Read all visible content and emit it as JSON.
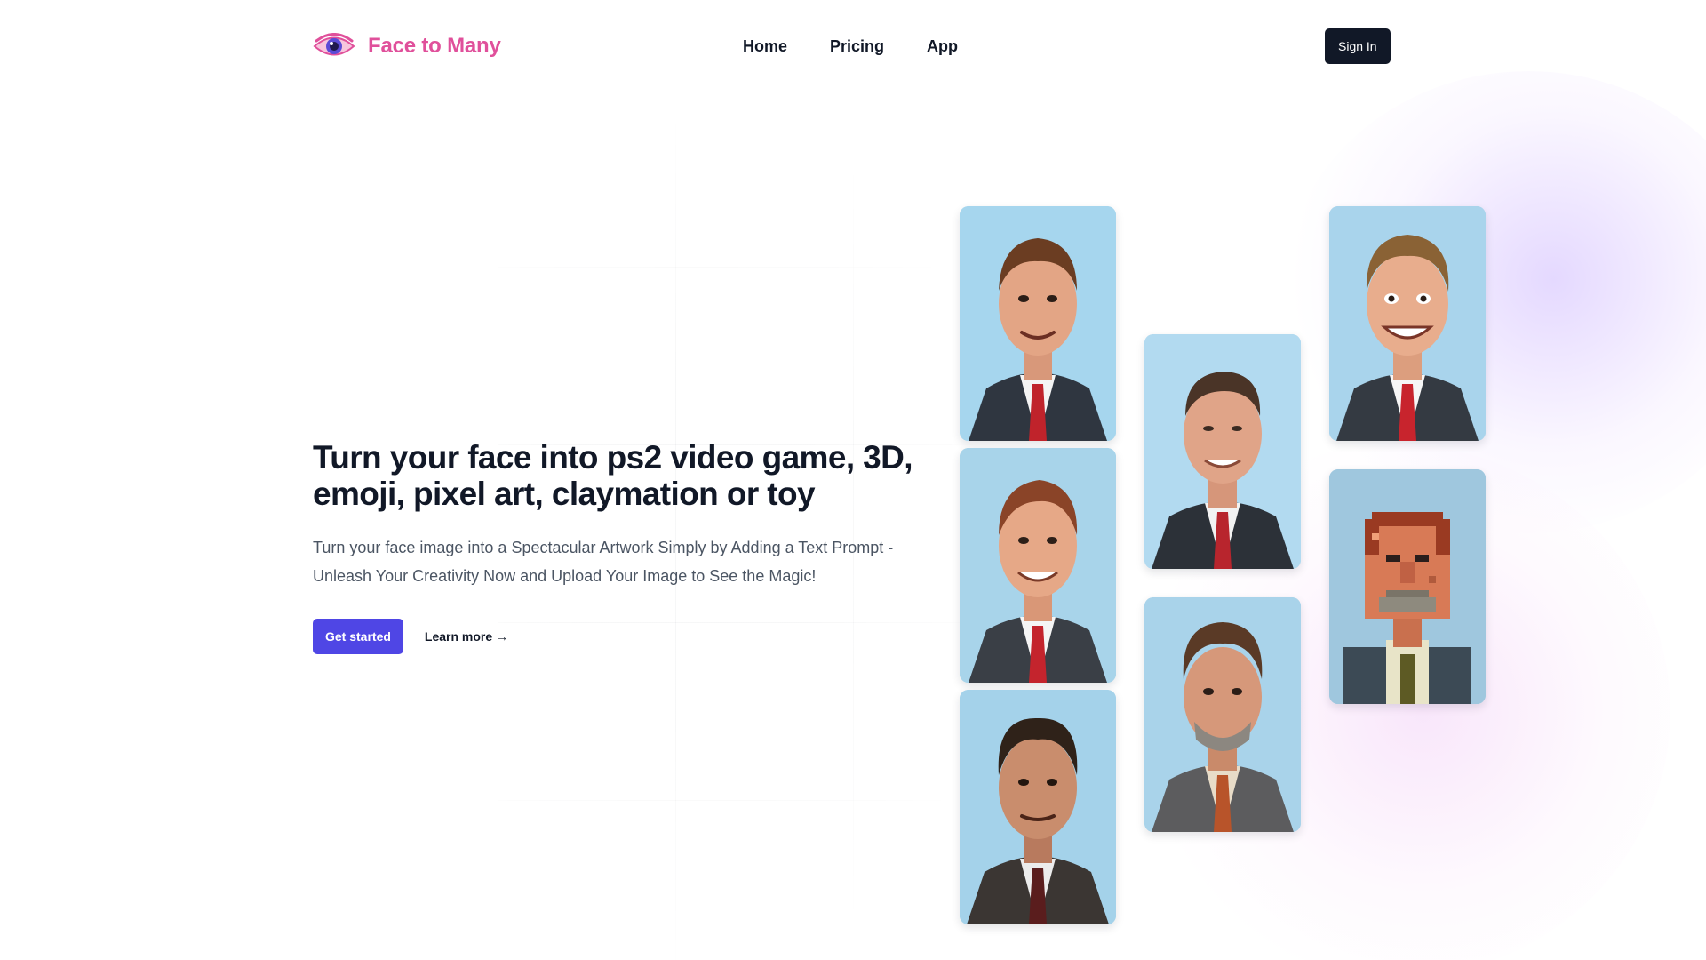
{
  "brand": {
    "name": "Face to Many",
    "logo_icon": "eye-icon",
    "accent": "#e0509b"
  },
  "nav": {
    "items": [
      {
        "label": "Home"
      },
      {
        "label": "Pricing"
      },
      {
        "label": "App"
      }
    ]
  },
  "header": {
    "signin_label": "Sign In"
  },
  "hero": {
    "title": "Turn your face into ps2 video game, 3D, emoji, pixel art, claymation or toy",
    "subtitle": "Turn your face image into a Spectacular Artwork Simply by Adding a Text Prompt - Unleash Your Creativity Now and Upload Your Image to See the Magic!",
    "primary_cta": "Get started",
    "secondary_cta": "Learn more →"
  },
  "gallery": {
    "images": [
      {
        "style": "3d"
      },
      {
        "style": "clay"
      },
      {
        "style": "video-game"
      },
      {
        "style": "photo"
      },
      {
        "style": "toy"
      },
      {
        "style": "emoji"
      },
      {
        "style": "pixel-art"
      }
    ]
  },
  "colors": {
    "primary_button": "#4f46e5",
    "dark_button": "#111827",
    "sky": "#9fd3ec"
  }
}
